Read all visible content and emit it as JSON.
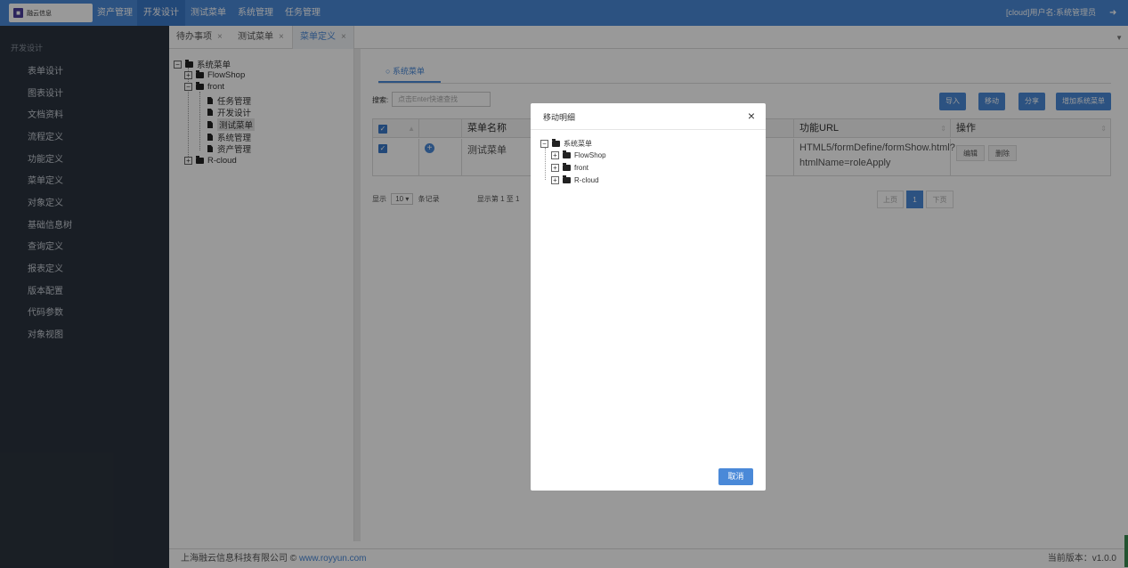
{
  "app": {
    "logo_text": "融云信息",
    "user": "[cloud]用户名:系统管理员"
  },
  "topnav": [
    "资产管理",
    "开发设计",
    "测试菜单",
    "系统管理",
    "任务管理"
  ],
  "sidebar": {
    "section": "开发设计",
    "items": [
      "表单设计",
      "图表设计",
      "文档资料",
      "流程定义",
      "功能定义",
      "菜单定义",
      "对象定义",
      "基础信息树",
      "查询定义",
      "报表定义",
      "版本配置",
      "代码参数",
      "对象视图"
    ]
  },
  "tabs": [
    {
      "label": "待办事项",
      "close": "×"
    },
    {
      "label": "测试菜单",
      "close": "×"
    },
    {
      "label": "菜单定义",
      "close": "×"
    }
  ],
  "tree": {
    "root": "系统菜单",
    "nodes": [
      {
        "label": "FlowShop",
        "toggle": "+"
      },
      {
        "label": "front",
        "toggle": "−"
      },
      {
        "label": "R-cloud",
        "toggle": "+"
      }
    ],
    "front_children": [
      "任务管理",
      "开发设计",
      "测试菜单",
      "系统管理",
      "资产管理"
    ]
  },
  "main": {
    "tab": "系统菜单",
    "search_label": "搜索:",
    "search_placeholder": "点击Enter快速查找",
    "buttons": [
      "导入",
      "移动",
      "分享",
      "增加系统菜单"
    ],
    "columns": [
      "菜单名称",
      "功能URL",
      "操作"
    ],
    "row": {
      "name": "测试菜单",
      "url": "HTML5/formDefine/formShow.html?htmlName=roleApply",
      "actions": [
        "编辑",
        "删除"
      ]
    },
    "pager": {
      "show": "显示",
      "size": "10",
      "records": "条记录",
      "info": "显示第 1 至 1",
      "prev": "上页",
      "page": "1",
      "next": "下页"
    }
  },
  "modal": {
    "title": "移动明细",
    "close": "×",
    "root": "系统菜单",
    "nodes": [
      "FlowShop",
      "front",
      "R-cloud"
    ],
    "cancel": "取消"
  },
  "footer": {
    "company": "上海融云信息科技有限公司 © ",
    "link": "www.royyun.com",
    "version": "当前版本：v1.0.0"
  }
}
